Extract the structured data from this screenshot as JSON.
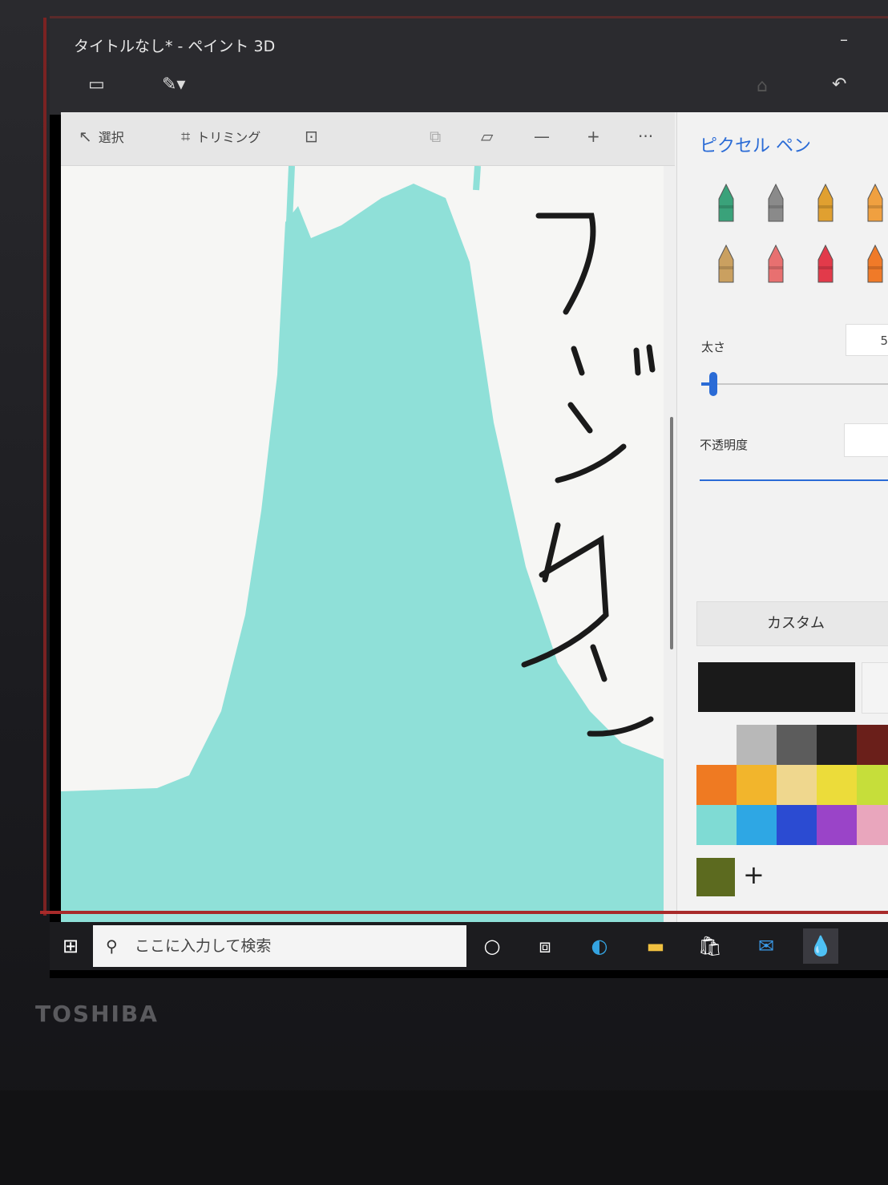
{
  "window": {
    "title": "タイトルなし* - ペイント 3D",
    "minimize": "–"
  },
  "menu": {
    "file_icon": "folder-icon",
    "brush_icon": "brush-icon",
    "undo_icon": "undo-icon"
  },
  "toolbar": {
    "select_label": "選択",
    "crop_label": "トリミング",
    "zoom_minus": "—",
    "zoom_plus": "+",
    "more": "···"
  },
  "panel": {
    "title": "ピクセル ペン",
    "thickness_label": "太さ",
    "thickness_value": "5",
    "opacity_label": "不透明度",
    "custom_button": "カスタム",
    "add_color": "+"
  },
  "brush_tools": [
    {
      "name": "marker",
      "color": "#3aa27a"
    },
    {
      "name": "calligraphy-pen",
      "color": "#8a8a8a"
    },
    {
      "name": "oil-brush",
      "color": "#e0a030"
    },
    {
      "name": "watercolor",
      "color": "#f0a040"
    },
    {
      "name": "pencil",
      "color": "#caa060"
    },
    {
      "name": "eraser",
      "color": "#e87070"
    },
    {
      "name": "crayon",
      "color": "#e23a4a"
    },
    {
      "name": "spray-can",
      "color": "#f07a28"
    }
  ],
  "palette": [
    "#f2f2f2",
    "#b8b8b8",
    "#5c5c5c",
    "#202020",
    "#6a1f1a",
    "#ef7a22",
    "#f2b52c",
    "#efd78e",
    "#ecdc3a",
    "#c6de3a",
    "#7fdbd4",
    "#2ea7e4",
    "#2b4bd2",
    "#9a44c8",
    "#e9a6bd"
  ],
  "custom_color": "#5c6a1f",
  "taskbar": {
    "search_placeholder": "ここに入力して検索",
    "icons": [
      "windows-icon",
      "cortana-icon",
      "taskview-icon",
      "edge-icon",
      "folder-icon",
      "store-icon",
      "mail-icon",
      "paint3d-icon"
    ]
  },
  "device": {
    "brand": "TOSHIBA"
  },
  "canvas_text": "フジサン"
}
